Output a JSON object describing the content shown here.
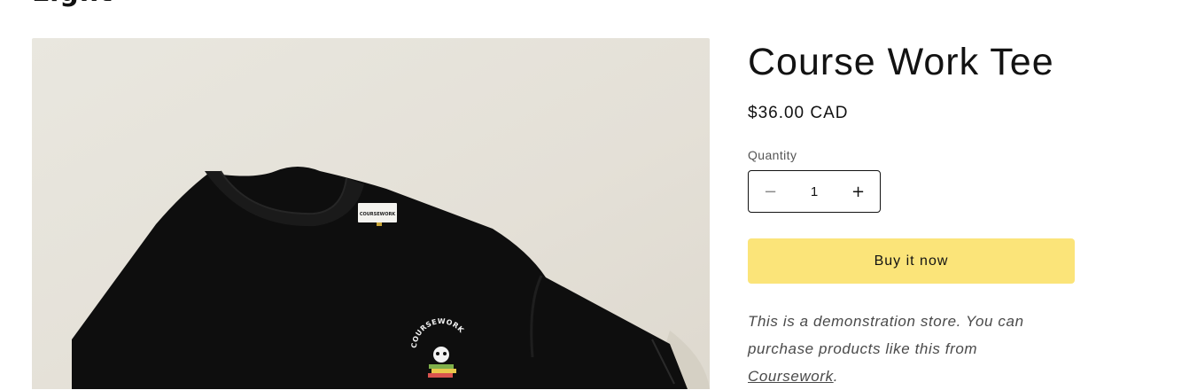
{
  "header": {
    "brand_fragment": "Light"
  },
  "product": {
    "image_alt": "Black t-shirt with Coursework logo",
    "shirt_label": "COURSEWORK",
    "chest_logo_text": "COURSEWORK",
    "title": "Course Work Tee",
    "price": "$36.00 CAD",
    "quantity": {
      "label": "Quantity",
      "value": "1",
      "decrease_icon": "minus-icon",
      "increase_icon": "plus-icon"
    },
    "buy_button": "Buy it now",
    "description": {
      "text": "This is a demonstration store. You can purchase products like this from ",
      "link_text": "Coursework",
      "end": "."
    }
  },
  "colors": {
    "buy_button_bg": "#fbe479",
    "image_background": "#e5e1d8",
    "shirt": "#0d0d0d"
  }
}
